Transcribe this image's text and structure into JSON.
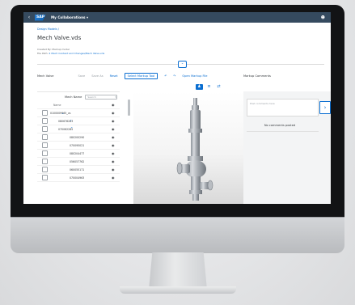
{
  "shell": {
    "back_icon": "back-arrow-icon",
    "logo": "SAP",
    "app_title": "My Collaborations ▾",
    "user_icon": "person-icon"
  },
  "breadcrumb": "Design Models /",
  "page_title": "Mech Valve.vds",
  "meta": {
    "created_by": "Created By: Markup model",
    "file_path_label": "File Path:",
    "file_path_value": "2 Mech Content and Changes/Mech Valve.vds"
  },
  "toolbar": {
    "view_label": "Mech Valve",
    "items": [
      "Save",
      "Save As",
      "Reset",
      "Select Markup Tool",
      "↶",
      "↷",
      "Open Markup File"
    ]
  },
  "markup": {
    "title": "Markup Comments",
    "placeholder": "Post comments here",
    "empty_text": "No comments posted"
  },
  "tree": {
    "column_label": "Mech Name",
    "search_placeholder": "Search",
    "header_name": "Name",
    "rows": [
      {
        "name": "0100009965_vs"
      },
      {
        "name": "080676283"
      },
      {
        "name": "070062285"
      },
      {
        "name": "080200290"
      },
      {
        "name": "070095021"
      },
      {
        "name": "080204477"
      },
      {
        "name": "056057762"
      },
      {
        "name": "060055171"
      },
      {
        "name": "070004963"
      }
    ]
  }
}
